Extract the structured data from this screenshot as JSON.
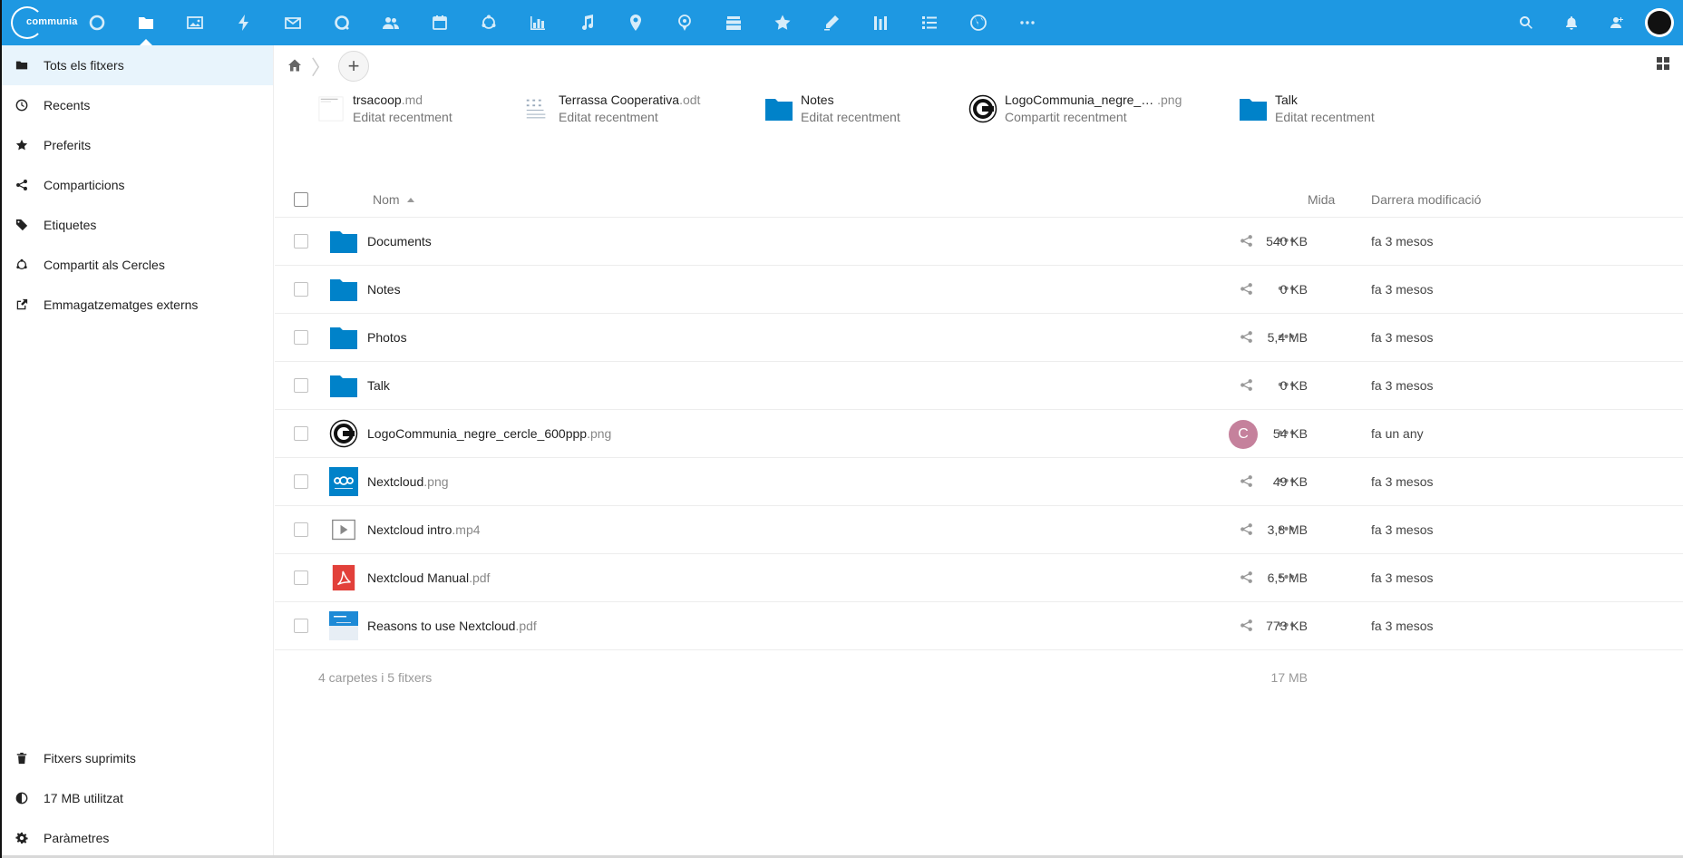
{
  "brand": {
    "logo_text": "communia",
    "accent": "#1e98e2"
  },
  "header": {
    "apps": [
      "dashboard-icon",
      "files-icon",
      "photos-icon",
      "activity-icon",
      "mail-icon",
      "talk-icon",
      "contacts-icon",
      "calendar-icon",
      "circles-icon",
      "analytics-icon",
      "music-icon",
      "maps-icon",
      "location-icon",
      "deck-icon",
      "bookmarks-icon",
      "notes-icon",
      "forms-icon",
      "tasks-icon",
      "web-icon",
      "more-apps-icon"
    ],
    "active_app": "files-icon"
  },
  "sidebar": {
    "items": [
      {
        "label": "Tots els fitxers",
        "icon": "folder-icon",
        "active": true
      },
      {
        "label": "Recents",
        "icon": "clock-icon"
      },
      {
        "label": "Preferits",
        "icon": "star-icon"
      },
      {
        "label": "Comparticions",
        "icon": "share-icon"
      },
      {
        "label": "Etiquetes",
        "icon": "tag-icon"
      },
      {
        "label": "Compartit als Cercles",
        "icon": "circles-icon"
      },
      {
        "label": "Emmagatzematges externs",
        "icon": "external-link-icon"
      }
    ],
    "bottom": [
      {
        "label": "Fitxers suprimits",
        "icon": "trash-icon"
      },
      {
        "label": "17 MB utilitzat",
        "icon": "pie-icon"
      },
      {
        "label": "Paràmetres",
        "icon": "gear-icon"
      }
    ]
  },
  "recent": [
    {
      "name": "trsacoop",
      "ext": ".md",
      "sub": "Editat recentment",
      "type": "doc"
    },
    {
      "name": "Terrassa Cooperativa",
      "ext": ".odt",
      "sub": "Editat recentment",
      "type": "odt"
    },
    {
      "name": "Notes",
      "ext": "",
      "sub": "Editat recentment",
      "type": "folder"
    },
    {
      "name": "LogoCommunia_negre_…",
      "ext": " .png",
      "sub": "Compartit recentment",
      "type": "logo"
    },
    {
      "name": "Talk",
      "ext": "",
      "sub": "Editat recentment",
      "type": "folder"
    }
  ],
  "table": {
    "headers": {
      "name": "Nom",
      "size": "Mida",
      "modified": "Darrera modificació"
    },
    "rows": [
      {
        "name": "Documents",
        "ext": "",
        "size": "540 KB",
        "modified": "fa 3 mesos",
        "type": "folder"
      },
      {
        "name": "Notes",
        "ext": "",
        "size": "0 KB",
        "modified": "fa 3 mesos",
        "type": "folder"
      },
      {
        "name": "Photos",
        "ext": "",
        "size": "5,4 MB",
        "modified": "fa 3 mesos",
        "type": "folder"
      },
      {
        "name": "Talk",
        "ext": "",
        "size": "0 KB",
        "modified": "fa 3 mesos",
        "type": "folder"
      },
      {
        "name": "LogoCommunia_negre_cercle_600ppp",
        "ext": ".png",
        "size": "54 KB",
        "modified": "fa un any",
        "type": "logo",
        "shared_avatar": "C"
      },
      {
        "name": "Nextcloud",
        "ext": ".png",
        "size": "49 KB",
        "modified": "fa 3 mesos",
        "type": "nextcloud"
      },
      {
        "name": "Nextcloud intro",
        "ext": ".mp4",
        "size": "3,8 MB",
        "modified": "fa 3 mesos",
        "type": "video"
      },
      {
        "name": "Nextcloud Manual",
        "ext": ".pdf",
        "size": "6,5 MB",
        "modified": "fa 3 mesos",
        "type": "pdf"
      },
      {
        "name": "Reasons to use Nextcloud",
        "ext": ".pdf",
        "size": "773 KB",
        "modified": "fa 3 mesos",
        "type": "pdfthumb"
      }
    ],
    "summary": {
      "count": "4 carpetes i 5 fitxers",
      "total": "17 MB"
    }
  }
}
